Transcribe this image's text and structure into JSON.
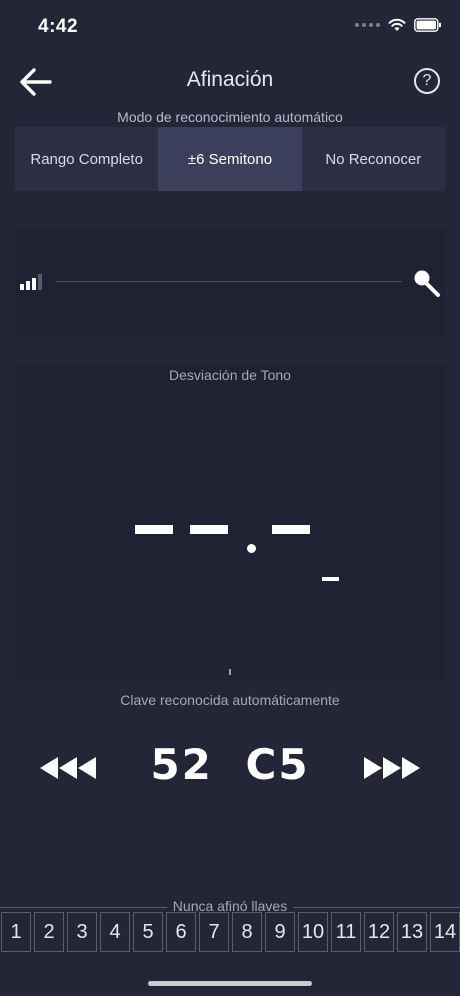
{
  "status_bar": {
    "time": "4:42"
  },
  "nav": {
    "title": "Afinación",
    "help_label": "?"
  },
  "mode": {
    "label": "Modo de reconocimiento automático",
    "options": [
      "Rango Completo",
      "±6 Semitono",
      "No Reconocer"
    ],
    "selected": "±6 Semitono"
  },
  "deviation": {
    "title": "Desviación de Tono"
  },
  "key": {
    "label": "Clave reconocida automáticamente",
    "value": "52 C5"
  },
  "tuned": {
    "label": "Nunca afinó llaves",
    "keys": [
      "1",
      "2",
      "3",
      "4",
      "5",
      "6",
      "7",
      "8",
      "9",
      "10",
      "11",
      "12",
      "13",
      "14"
    ]
  },
  "colors": {
    "background": "#242638",
    "panel": "#202233",
    "segment_active": "#3b3f5c",
    "segment": "#2c2f43"
  }
}
